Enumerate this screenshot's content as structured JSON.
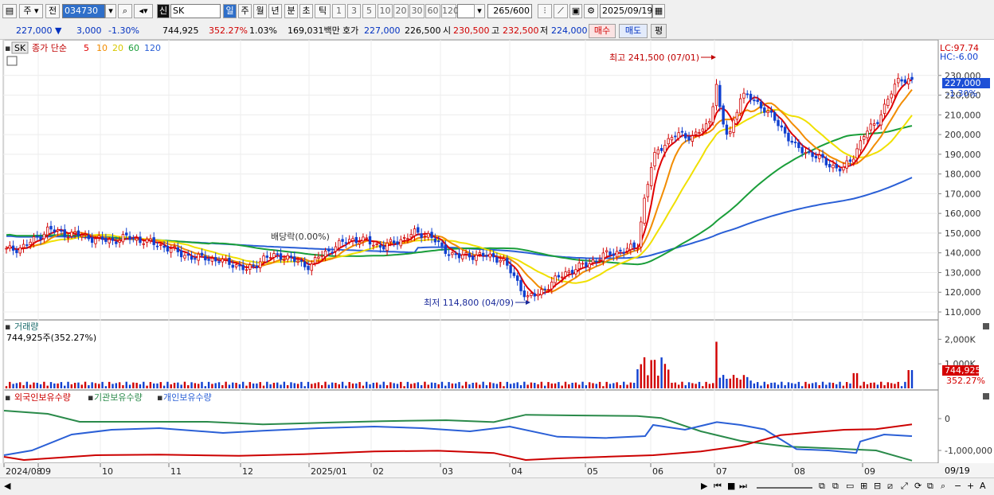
{
  "toolbar": {
    "code_type": "주",
    "prev_btn": "전",
    "stock_code": "034730",
    "market_tag": "신",
    "stock_name": "SK",
    "periods": [
      "일",
      "주",
      "월",
      "년",
      "분",
      "초",
      "틱"
    ],
    "active_period": "일",
    "intervals": [
      "1",
      "3",
      "5",
      "10",
      "20",
      "30",
      "60",
      "120"
    ],
    "count_value": "265",
    "count_total": "/600",
    "date": "2025/09/19"
  },
  "quote": {
    "price": "227,000",
    "change": "3,000",
    "change_pct": "-1.30%",
    "volume": "744,925",
    "volume_ratio": "352.27%",
    "turnover_pct": "1.03%",
    "amount": "169,031백만",
    "bid_label": "호가",
    "ask_price": "227,000",
    "bid_price": "226,500",
    "open_label": "시",
    "open": "230,500",
    "high_label": "고",
    "high": "232,500",
    "low_label": "저",
    "low": "224,000",
    "buy_btn": "매수",
    "sell_btn": "매도",
    "eval_btn": "평"
  },
  "price_panel": {
    "name": "SK",
    "legend_title": "종가 단순",
    "ma_legend": [
      {
        "label": "5",
        "color": "#e00000"
      },
      {
        "label": "10",
        "color": "#f28c00"
      },
      {
        "label": "20",
        "color": "#f0e000"
      },
      {
        "label": "60",
        "color": "#1a9e3a"
      },
      {
        "label": "120",
        "color": "#2a5fd6"
      }
    ],
    "lc": "LC:97.74",
    "hc": "HC:-6.00",
    "current_tag": "227,000",
    "current_pct": "-1.30%",
    "high_annotation": "최고 241,500 (07/01)",
    "low_annotation": "최저 114,800 (04/09)",
    "dividend_annotation": "배당락(0.00%)",
    "y_ticks": [
      "230,000",
      "220,000",
      "210,000",
      "200,000",
      "190,000",
      "180,000",
      "170,000",
      "160,000",
      "150,000",
      "140,000",
      "130,000",
      "120,000",
      "110,000"
    ]
  },
  "volume_panel": {
    "title": "거래량",
    "value_label": "744,925주(352.27%)",
    "y_ticks": [
      "2,000K",
      "1,000K"
    ],
    "tag_value": "744,925",
    "tag_pct": "352.27%"
  },
  "holding_panel": {
    "legends": [
      {
        "label": "외국인보유수량",
        "color": "#cc0000"
      },
      {
        "label": "기관보유수량",
        "color": "#2a8a4a"
      },
      {
        "label": "개인보유수량",
        "color": "#2a5fd6"
      }
    ],
    "y_ticks": [
      "0",
      "-1,000,000"
    ]
  },
  "x_axis": {
    "labels": [
      "2024/08",
      "09",
      "10",
      "11",
      "12",
      "2025/01",
      "02",
      "03",
      "04",
      "05",
      "06",
      "07",
      "08",
      "09"
    ],
    "end_label": "09/19"
  },
  "colors": {
    "up": "#d10000",
    "down": "#1040d0",
    "ma5": "#e00000",
    "ma10": "#f28c00",
    "ma20": "#f0e000",
    "ma60": "#1a9e3a",
    "ma120": "#2a5fd6"
  },
  "chart_data": {
    "type": "candlestick",
    "unit": "KRW",
    "ylim": [
      110000,
      240000
    ],
    "monthly_close_estimates": [
      {
        "month": "2024/08",
        "close": 141000
      },
      {
        "month": "2024/09",
        "close": 152000
      },
      {
        "month": "2024/10",
        "close": 148000
      },
      {
        "month": "2024/11",
        "close": 137000
      },
      {
        "month": "2024/12",
        "close": 136000
      },
      {
        "month": "2025/01",
        "close": 145000
      },
      {
        "month": "2025/02",
        "close": 150000
      },
      {
        "month": "2025/03",
        "close": 138000
      },
      {
        "month": "2025/04",
        "close": 125000
      },
      {
        "month": "2025/05",
        "close": 142000
      },
      {
        "month": "2025/06",
        "close": 200000
      },
      {
        "month": "2025/07",
        "close": 218000
      },
      {
        "month": "2025/08",
        "close": 185000
      },
      {
        "month": "2025/09",
        "close": 227000
      }
    ],
    "period_high": 241500,
    "period_low": 114800
  }
}
